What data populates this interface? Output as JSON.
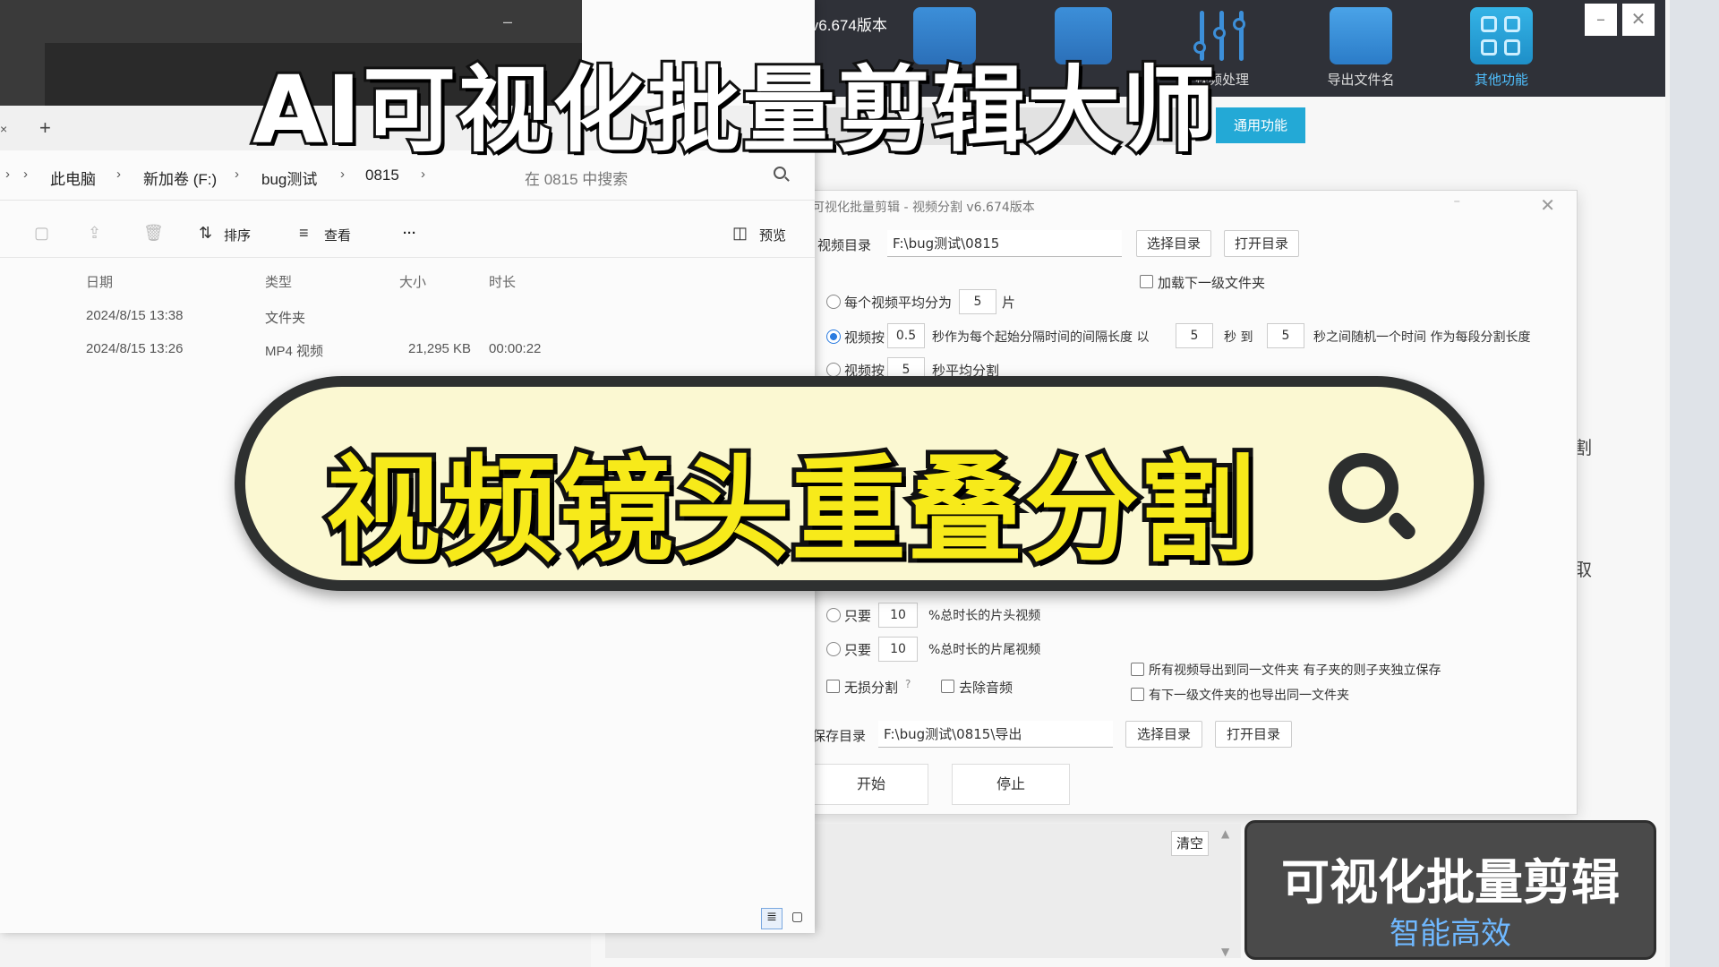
{
  "app": {
    "title": "AI可视化批量剪辑 v6.674版本",
    "tools": [
      {
        "label": ""
      },
      {
        "label": ""
      },
      {
        "label": "视频处理"
      },
      {
        "label": "导出文件名"
      },
      {
        "label": "其他功能"
      }
    ],
    "minimize": "–",
    "close": "✕",
    "common_tab": "通用功能",
    "peek_right": [
      "割",
      "取"
    ]
  },
  "dialog": {
    "title": "可视化批量剪辑 - 视频分割  v6.674版本",
    "close": "✕",
    "minimize": "–",
    "video_dir_label": "视频目录",
    "video_dir_value": "F:\\bug测试\\0815",
    "choose_dir": "选择目录",
    "open_dir": "打开目录",
    "load_subfolder": "加载下一级文件夹",
    "opt_avg_label": "每个视频平均分为",
    "opt_avg_value": "5",
    "opt_avg_unit": "片",
    "opt_interval_label": "视频按",
    "opt_interval_value": "0.5",
    "opt_interval_mid": "秒作为每个起始分隔时间的间隔长度 以",
    "opt_interval_from": "5",
    "opt_interval_to_label": "秒 到",
    "opt_interval_to": "5",
    "opt_interval_tail": "秒之间随机一个时间 作为每段分割长度",
    "opt_even_label": "视频按",
    "opt_even_value": "5",
    "opt_even_tail": "秒平均分割",
    "head_only": "只要",
    "head_value": "10",
    "head_tail": "%总时长的片头视频",
    "tail_only": "只要",
    "tail_value": "10",
    "tail_tail": "%总时长的片尾视频",
    "lossless": "无损分割",
    "help": "?",
    "remove_audio": "去除音频",
    "all_same_folder": "所有视频导出到同一文件夹 有子夹的则子夹独立保存",
    "sub_same_folder": "有下一级文件夹的也导出同一文件夹",
    "save_dir_label": "保存目录",
    "save_dir_value": "F:\\bug测试\\0815\\导出",
    "save_choose": "选择目录",
    "save_open": "打开目录",
    "start": "开始",
    "stop": "停止"
  },
  "log": {
    "clear": "清空"
  },
  "explorer": {
    "minimize": "–",
    "add_tab": "+",
    "tab_close": "×",
    "breadcrumb": [
      "此电脑",
      "新加卷 (F:)",
      "bug测试",
      "0815"
    ],
    "search_placeholder": "在 0815 中搜索",
    "toolbar": {
      "sort": "排序",
      "view": "查看",
      "more": "···",
      "preview": "预览"
    },
    "columns": [
      "日期",
      "类型",
      "大小",
      "时长"
    ],
    "rows": [
      {
        "date": "2024/8/15 13:38",
        "type": "文件夹",
        "size": "",
        "duration": ""
      },
      {
        "date": "2024/8/15 13:26",
        "type": "MP4 视频",
        "size": "21,295 KB",
        "duration": "00:00:22"
      }
    ]
  },
  "overlay": {
    "headline": "AI可视化批量剪辑大师",
    "banner": "视频镜头重叠分割",
    "promo_title": "可视化批量剪辑",
    "promo_sub": "智能高效"
  },
  "colors": {
    "accent": "#23a9d6",
    "banner_text": "#f7ea1a",
    "promo_sub": "#6fb8ff"
  }
}
